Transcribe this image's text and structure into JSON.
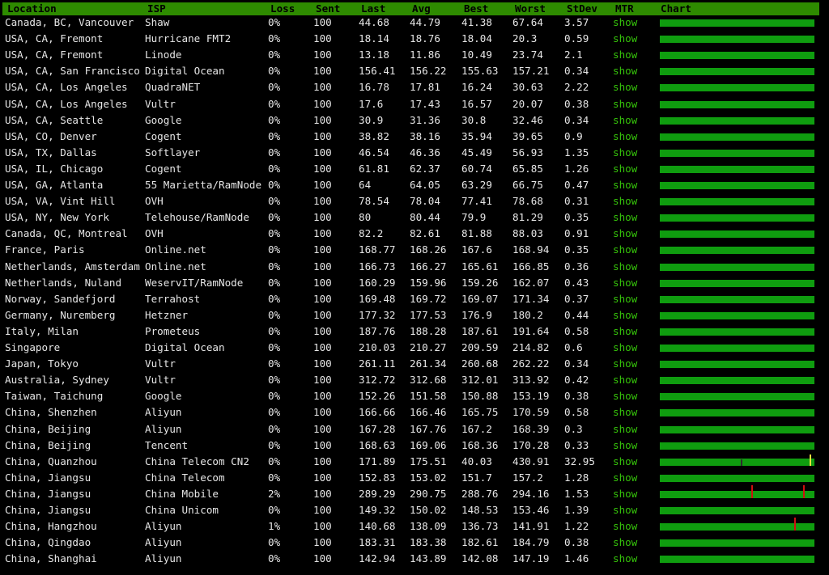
{
  "columns": {
    "location": "Location",
    "isp": "ISP",
    "loss": "Loss",
    "sent": "Sent",
    "last": "Last",
    "avg": "Avg",
    "best": "Best",
    "worst": "Worst",
    "stdev": "StDev",
    "mtr": "MTR",
    "chart": "Chart"
  },
  "rows": [
    {
      "location": "Canada, BC, Vancouver",
      "isp": "Shaw",
      "loss": "0%",
      "sent": "100",
      "last": "44.68",
      "avg": "44.79",
      "best": "41.38",
      "worst": "67.64",
      "stdev": "3.57",
      "mtr": "show"
    },
    {
      "location": "USA, CA, Fremont",
      "isp": "Hurricane FMT2",
      "loss": "0%",
      "sent": "100",
      "last": "18.14",
      "avg": "18.76",
      "best": "18.04",
      "worst": "20.3",
      "stdev": "0.59",
      "mtr": "show"
    },
    {
      "location": "USA, CA, Fremont",
      "isp": "Linode",
      "loss": "0%",
      "sent": "100",
      "last": "13.18",
      "avg": "11.86",
      "best": "10.49",
      "worst": "23.74",
      "stdev": "2.1",
      "mtr": "show"
    },
    {
      "location": "USA, CA, San Francisco",
      "isp": "Digital Ocean",
      "loss": "0%",
      "sent": "100",
      "last": "156.41",
      "avg": "156.22",
      "best": "155.63",
      "worst": "157.21",
      "stdev": "0.34",
      "mtr": "show"
    },
    {
      "location": "USA, CA, Los Angeles",
      "isp": "QuadraNET",
      "loss": "0%",
      "sent": "100",
      "last": "16.78",
      "avg": "17.81",
      "best": "16.24",
      "worst": "30.63",
      "stdev": "2.22",
      "mtr": "show"
    },
    {
      "location": "USA, CA, Los Angeles",
      "isp": "Vultr",
      "loss": "0%",
      "sent": "100",
      "last": "17.6",
      "avg": "17.43",
      "best": "16.57",
      "worst": "20.07",
      "stdev": "0.38",
      "mtr": "show"
    },
    {
      "location": "USA, CA, Seattle",
      "isp": "Google",
      "loss": "0%",
      "sent": "100",
      "last": "30.9",
      "avg": "31.36",
      "best": "30.8",
      "worst": "32.46",
      "stdev": "0.34",
      "mtr": "show"
    },
    {
      "location": "USA, CO, Denver",
      "isp": "Cogent",
      "loss": "0%",
      "sent": "100",
      "last": "38.82",
      "avg": "38.16",
      "best": "35.94",
      "worst": "39.65",
      "stdev": "0.9",
      "mtr": "show"
    },
    {
      "location": "USA, TX, Dallas",
      "isp": "Softlayer",
      "loss": "0%",
      "sent": "100",
      "last": "46.54",
      "avg": "46.36",
      "best": "45.49",
      "worst": "56.93",
      "stdev": "1.35",
      "mtr": "show"
    },
    {
      "location": "USA, IL, Chicago",
      "isp": "Cogent",
      "loss": "0%",
      "sent": "100",
      "last": "61.81",
      "avg": "62.37",
      "best": "60.74",
      "worst": "65.85",
      "stdev": "1.26",
      "mtr": "show"
    },
    {
      "location": "USA, GA, Atlanta",
      "isp": "55 Marietta/RamNode",
      "loss": "0%",
      "sent": "100",
      "last": "64",
      "avg": "64.05",
      "best": "63.29",
      "worst": "66.75",
      "stdev": "0.47",
      "mtr": "show"
    },
    {
      "location": "USA, VA, Vint Hill",
      "isp": "OVH",
      "loss": "0%",
      "sent": "100",
      "last": "78.54",
      "avg": "78.04",
      "best": "77.41",
      "worst": "78.68",
      "stdev": "0.31",
      "mtr": "show"
    },
    {
      "location": "USA, NY, New York",
      "isp": "Telehouse/RamNode",
      "loss": "0%",
      "sent": "100",
      "last": "80",
      "avg": "80.44",
      "best": "79.9",
      "worst": "81.29",
      "stdev": "0.35",
      "mtr": "show"
    },
    {
      "location": "Canada, QC, Montreal",
      "isp": "OVH",
      "loss": "0%",
      "sent": "100",
      "last": "82.2",
      "avg": "82.61",
      "best": "81.88",
      "worst": "88.03",
      "stdev": "0.91",
      "mtr": "show"
    },
    {
      "location": "France, Paris",
      "isp": "Online.net",
      "loss": "0%",
      "sent": "100",
      "last": "168.77",
      "avg": "168.26",
      "best": "167.6",
      "worst": "168.94",
      "stdev": "0.35",
      "mtr": "show"
    },
    {
      "location": "Netherlands, Amsterdam",
      "isp": "Online.net",
      "loss": "0%",
      "sent": "100",
      "last": "166.73",
      "avg": "166.27",
      "best": "165.61",
      "worst": "166.85",
      "stdev": "0.36",
      "mtr": "show"
    },
    {
      "location": "Netherlands, Nuland",
      "isp": "WeservIT/RamNode",
      "loss": "0%",
      "sent": "100",
      "last": "160.29",
      "avg": "159.96",
      "best": "159.26",
      "worst": "162.07",
      "stdev": "0.43",
      "mtr": "show"
    },
    {
      "location": "Norway, Sandefjord",
      "isp": "Terrahost",
      "loss": "0%",
      "sent": "100",
      "last": "169.48",
      "avg": "169.72",
      "best": "169.07",
      "worst": "171.34",
      "stdev": "0.37",
      "mtr": "show"
    },
    {
      "location": "Germany, Nuremberg",
      "isp": "Hetzner",
      "loss": "0%",
      "sent": "100",
      "last": "177.32",
      "avg": "177.53",
      "best": "176.9",
      "worst": "180.2",
      "stdev": "0.44",
      "mtr": "show"
    },
    {
      "location": "Italy, Milan",
      "isp": "Prometeus",
      "loss": "0%",
      "sent": "100",
      "last": "187.76",
      "avg": "188.28",
      "best": "187.61",
      "worst": "191.64",
      "stdev": "0.58",
      "mtr": "show"
    },
    {
      "location": "Singapore",
      "isp": "Digital Ocean",
      "loss": "0%",
      "sent": "100",
      "last": "210.03",
      "avg": "210.27",
      "best": "209.59",
      "worst": "214.82",
      "stdev": "0.6",
      "mtr": "show"
    },
    {
      "location": "Japan, Tokyo",
      "isp": "Vultr",
      "loss": "0%",
      "sent": "100",
      "last": "261.11",
      "avg": "261.34",
      "best": "260.68",
      "worst": "262.22",
      "stdev": "0.34",
      "mtr": "show"
    },
    {
      "location": "Australia, Sydney",
      "isp": "Vultr",
      "loss": "0%",
      "sent": "100",
      "last": "312.72",
      "avg": "312.68",
      "best": "312.01",
      "worst": "313.92",
      "stdev": "0.42",
      "mtr": "show"
    },
    {
      "location": "Taiwan, Taichung",
      "isp": "Google",
      "loss": "0%",
      "sent": "100",
      "last": "152.26",
      "avg": "151.58",
      "best": "150.88",
      "worst": "153.19",
      "stdev": "0.38",
      "mtr": "show"
    },
    {
      "location": "China, Shenzhen",
      "isp": "Aliyun",
      "loss": "0%",
      "sent": "100",
      "last": "166.66",
      "avg": "166.46",
      "best": "165.75",
      "worst": "170.59",
      "stdev": "0.58",
      "mtr": "show"
    },
    {
      "location": "China, Beijing",
      "isp": "Aliyun",
      "loss": "0%",
      "sent": "100",
      "last": "167.28",
      "avg": "167.76",
      "best": "167.2",
      "worst": "168.39",
      "stdev": "0.3",
      "mtr": "show"
    },
    {
      "location": "China, Beijing",
      "isp": "Tencent",
      "loss": "0%",
      "sent": "100",
      "last": "168.63",
      "avg": "169.06",
      "best": "168.36",
      "worst": "170.28",
      "stdev": "0.33",
      "mtr": "show"
    },
    {
      "location": "China, Quanzhou",
      "isp": "China Telecom CN2",
      "loss": "0%",
      "sent": "100",
      "last": "171.89",
      "avg": "175.51",
      "best": "40.03",
      "worst": "430.91",
      "stdev": "32.95",
      "mtr": "show"
    },
    {
      "location": "China, Jiangsu",
      "isp": "China Telecom",
      "loss": "0%",
      "sent": "100",
      "last": "152.83",
      "avg": "153.02",
      "best": "151.7",
      "worst": "157.2",
      "stdev": "1.28",
      "mtr": "show"
    },
    {
      "location": "China, Jiangsu",
      "isp": "China Mobile",
      "loss": "2%",
      "sent": "100",
      "last": "289.29",
      "avg": "290.75",
      "best": "288.76",
      "worst": "294.16",
      "stdev": "1.53",
      "mtr": "show"
    },
    {
      "location": "China, Jiangsu",
      "isp": "China Unicom",
      "loss": "0%",
      "sent": "100",
      "last": "149.32",
      "avg": "150.02",
      "best": "148.53",
      "worst": "153.46",
      "stdev": "1.39",
      "mtr": "show"
    },
    {
      "location": "China, Hangzhou",
      "isp": "Aliyun",
      "loss": "1%",
      "sent": "100",
      "last": "140.68",
      "avg": "138.09",
      "best": "136.73",
      "worst": "141.91",
      "stdev": "1.22",
      "mtr": "show"
    },
    {
      "location": "China, Qingdao",
      "isp": "Aliyun",
      "loss": "0%",
      "sent": "100",
      "last": "183.31",
      "avg": "183.38",
      "best": "182.61",
      "worst": "184.79",
      "stdev": "0.38",
      "mtr": "show"
    },
    {
      "location": "China, Shanghai",
      "isp": "Aliyun",
      "loss": "0%",
      "sent": "100",
      "last": "142.94",
      "avg": "143.89",
      "best": "142.08",
      "worst": "147.19",
      "stdev": "1.46",
      "mtr": "show"
    }
  ],
  "colors": {
    "header_bg": "#2e8b00",
    "chart_bar": "#0f9d0f",
    "link": "#35c20a",
    "loss_spike": "#d01010",
    "jitter_spike": "#f0e040"
  }
}
